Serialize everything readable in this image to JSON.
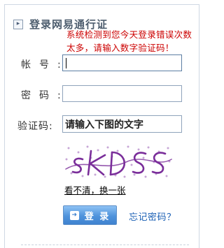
{
  "header": {
    "title": "登录网易通行证",
    "icon": "chevron-right-icon"
  },
  "warning": {
    "text": "系统检测到您今天登录错误次数太多，请输入数字验证码！",
    "color": "#cc0000"
  },
  "form": {
    "account_label": "帐号:",
    "password_label": "密码:",
    "captcha_label": "验证码:",
    "account_value": "",
    "password_value": "",
    "captcha_value": "请输入下图的文字"
  },
  "captcha": {
    "text": "sKDSS",
    "refresh_label": "看不清，换一张",
    "color": "#7a2e9a"
  },
  "actions": {
    "login_label": "登 录",
    "forgot_label": "忘记密码？",
    "accent": "#4f93dc"
  }
}
